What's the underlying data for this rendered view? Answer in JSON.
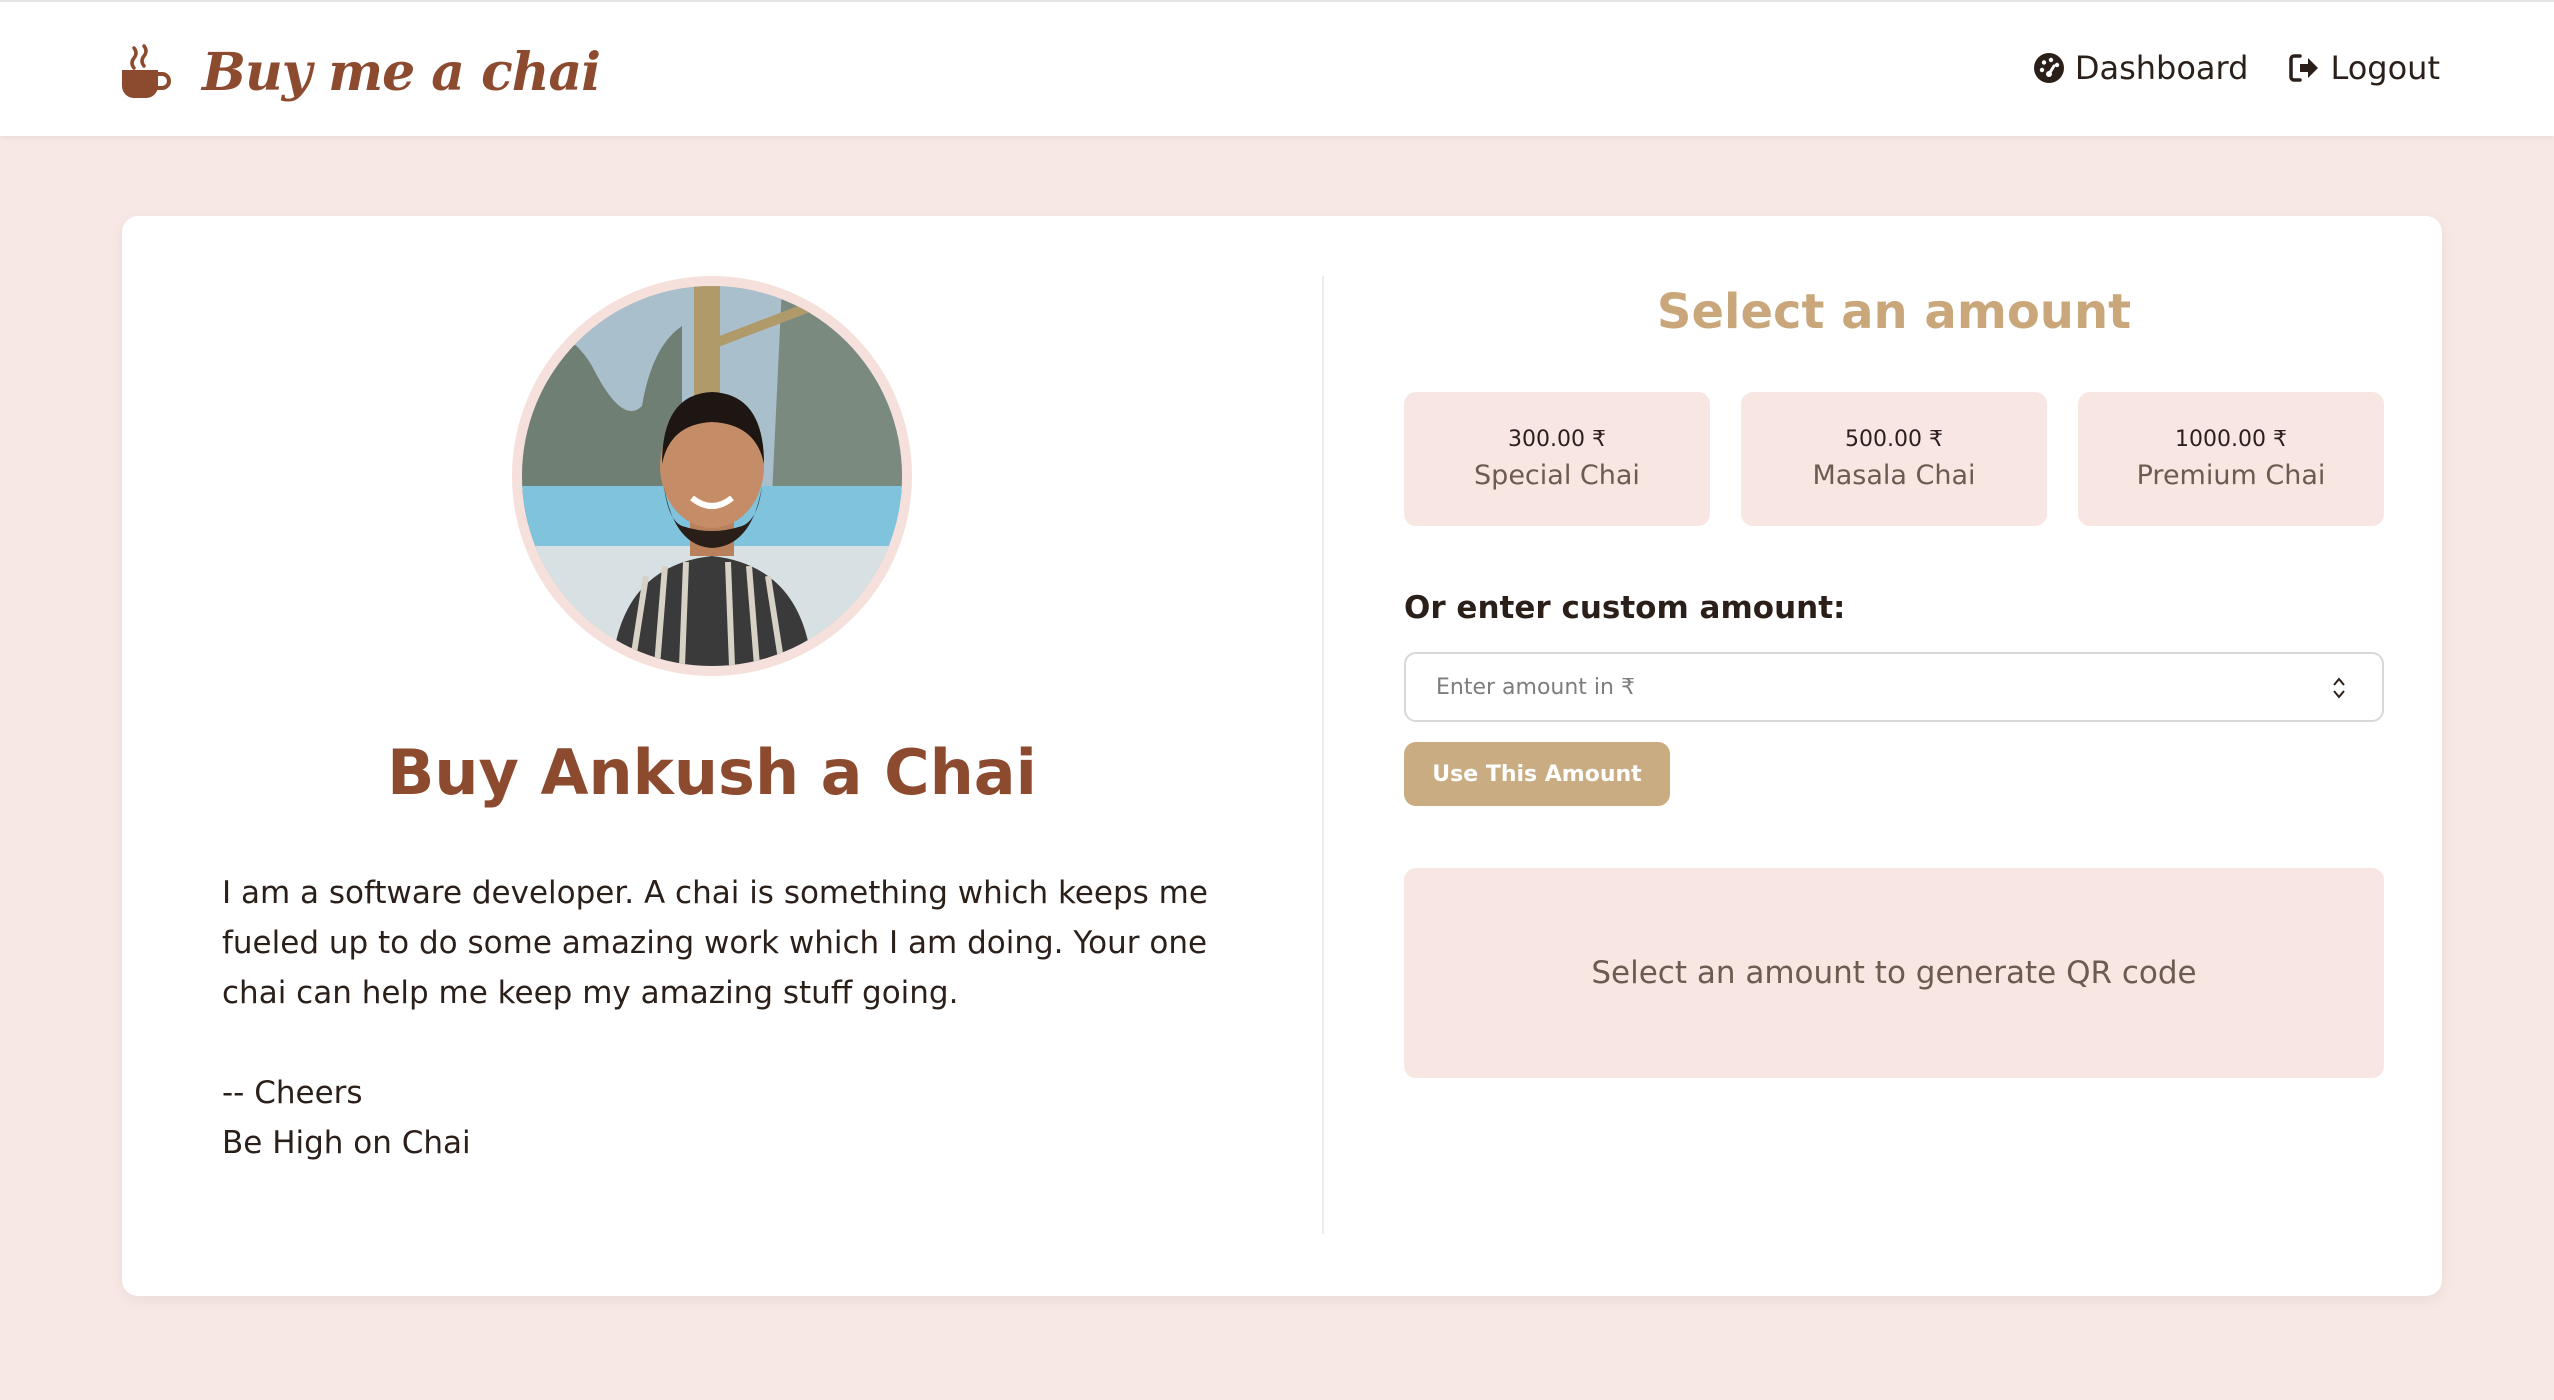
{
  "brand": {
    "name": "Buy me a chai",
    "icon": "coffee-cup-icon",
    "color": "#8c4a2f"
  },
  "nav": {
    "items": [
      {
        "label": "Dashboard",
        "icon": "gauge-icon"
      },
      {
        "label": "Logout",
        "icon": "sign-out-icon"
      }
    ]
  },
  "profile": {
    "title": "Buy Ankush a Chai",
    "bio": [
      "I am a software developer. A chai is something which keeps me fueled up to do some amazing work which I am doing. Your one chai can help me keep my amazing stuff going.",
      "-- Cheers",
      "Be High on Chai"
    ]
  },
  "payment": {
    "title": "Select an amount",
    "amounts": [
      {
        "price": "300.00 ₹",
        "name": "Special Chai"
      },
      {
        "price": "500.00 ₹",
        "name": "Masala Chai"
      },
      {
        "price": "1000.00 ₹",
        "name": "Premium Chai"
      }
    ],
    "custom_label": "Or enter custom amount:",
    "custom_placeholder": "Enter amount in ₹",
    "use_button": "Use This Amount",
    "qr_message": "Select an amount to generate QR code"
  },
  "colors": {
    "accent": "#c9a77b",
    "brown": "#8c4a2f",
    "background": "#f8e8e5",
    "tile": "#f8e6e2"
  }
}
